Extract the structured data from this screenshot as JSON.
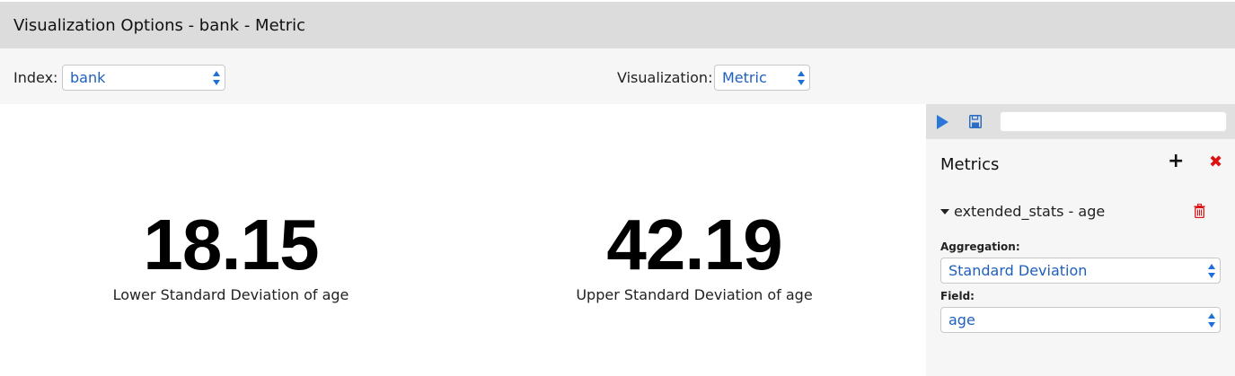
{
  "window": {
    "title": "Visualization Options - bank - Metric"
  },
  "options": {
    "index_label": "Index:",
    "index_value": "bank",
    "visualization_label": "Visualization:",
    "visualization_value": "Metric"
  },
  "metrics": [
    {
      "value": "18.15",
      "label": "Lower Standard Deviation of age"
    },
    {
      "value": "42.19",
      "label": "Upper Standard Deviation of age"
    }
  ],
  "panel": {
    "toolbar": {
      "run_icon": "play-icon",
      "save_icon": "save-icon",
      "search_value": ""
    },
    "title": "Metrics",
    "add_icon": "plus-icon",
    "close_icon": "close-icon",
    "aggregation_item": {
      "header": "extended_stats - age",
      "delete_icon": "trash-icon",
      "aggregation_label": "Aggregation:",
      "aggregation_value": "Standard Deviation",
      "field_label": "Field:",
      "field_value": "age"
    }
  },
  "colors": {
    "accent": "#1f5fbf",
    "danger": "#dd1111",
    "title_bar": "#dcdcdc",
    "panel_bg": "#f6f6f6"
  }
}
